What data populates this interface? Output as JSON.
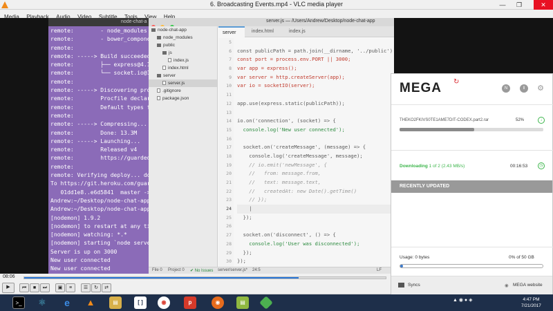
{
  "vlc": {
    "title": "6. Broadcasting Events.mp4 - VLC media player",
    "menu": [
      "Media",
      "Playback",
      "Audio",
      "Video",
      "Subtitle",
      "Tools",
      "View",
      "Help"
    ],
    "time_elapsed": "08:06",
    "progress": 0.76
  },
  "terminal": {
    "title": "node-chat-a",
    "lines": [
      "remote:        - node_modules",
      "remote:        - bower_componen",
      "remote:",
      "remote: -----> Build succeeded!",
      "remote:        ├── express@4.14",
      "remote:        └── socket.io@1.",
      "remote:",
      "remote: -----> Discovering proc",
      "remote:        Procfile declare",
      "remote:        Default types f",
      "remote:",
      "remote: -----> Compressing...",
      "remote:        Done: 13.3M",
      "remote: -----> Launching...",
      "remote:        Released v4",
      "remote:        https://guarded-",
      "remote:",
      "remote: Verifying deploy... do",
      "To https://git.heroku.com/guar",
      "   01dd1e8..e6d5841  master ->",
      "Andrew:~/Desktop/node-chat-app",
      "Andrew:~/Desktop/node-chat-app",
      "[nodemon] 1.9.2",
      "[nodemon] to restart at any ti",
      "[nodemon] watching: *.*",
      "[nodemon] starting `node server",
      "Server is up on 3000",
      "New user connected",
      "New user connected"
    ]
  },
  "atom": {
    "window_title": "server.js — /Users/Andrew/Desktop/node-chat-app",
    "tree": [
      {
        "label": "node-chat-app",
        "type": "folder",
        "indent": 0
      },
      {
        "label": "node_modules",
        "type": "folder",
        "indent": 1
      },
      {
        "label": "public",
        "type": "folder",
        "indent": 1
      },
      {
        "label": "js",
        "type": "folder",
        "indent": 2
      },
      {
        "label": "index.js",
        "type": "file",
        "indent": 3
      },
      {
        "label": "index.html",
        "type": "file",
        "indent": 2
      },
      {
        "label": "server",
        "type": "folder",
        "indent": 1
      },
      {
        "label": "server.js",
        "type": "file",
        "indent": 2,
        "selected": true
      },
      {
        "label": ".gitignore",
        "type": "file",
        "indent": 1
      },
      {
        "label": "package.json",
        "type": "file",
        "indent": 1
      }
    ],
    "tabs": [
      "server",
      "index.html",
      "index.js"
    ],
    "line_numbers": [
      "5",
      "6",
      "7",
      "8",
      "9",
      "10",
      "11",
      "12",
      "13",
      "14",
      "15",
      "16",
      "17",
      "18",
      "19",
      "20",
      "21",
      "22",
      "23",
      "24",
      "25",
      "26",
      "27",
      "28",
      "29",
      "30",
      "31",
      "32",
      "33",
      "34"
    ],
    "code_lines": [
      {
        "t": "",
        "c": ""
      },
      {
        "t": "const publicPath = path.join(__dirname, '../public');",
        "c": ""
      },
      {
        "t": "const port = process.env.PORT || 3000;",
        "c": "k"
      },
      {
        "t": "var app = express();",
        "c": "k"
      },
      {
        "t": "var server = http.createServer(app);",
        "c": "k"
      },
      {
        "t": "var io = socketIO(server);",
        "c": "k"
      },
      {
        "t": "",
        "c": ""
      },
      {
        "t": "app.use(express.static(publicPath));",
        "c": ""
      },
      {
        "t": "",
        "c": ""
      },
      {
        "t": "io.on('connection', (socket) => {",
        "c": ""
      },
      {
        "t": "  console.log('New user connected');",
        "c": "g"
      },
      {
        "t": "",
        "c": ""
      },
      {
        "t": "  socket.on('createMessage', (message) => {",
        "c": ""
      },
      {
        "t": "    console.log('createMessage', message);",
        "c": ""
      },
      {
        "t": "    // io.emit('newMessage', {",
        "c": "c"
      },
      {
        "t": "    //   from: message.from,",
        "c": "c"
      },
      {
        "t": "    //   text: message.text,",
        "c": "c"
      },
      {
        "t": "    //   createdAt: new Date().getTime()",
        "c": "c"
      },
      {
        "t": "    // });",
        "c": "c"
      },
      {
        "t": "    |",
        "c": "hl"
      },
      {
        "t": "  });",
        "c": ""
      },
      {
        "t": "",
        "c": ""
      },
      {
        "t": "  socket.on('disconnect', () => {",
        "c": ""
      },
      {
        "t": "    console.log('User was disconnected');",
        "c": "g"
      },
      {
        "t": "  });",
        "c": ""
      },
      {
        "t": "});",
        "c": ""
      },
      {
        "t": "",
        "c": ""
      },
      {
        "t": "server.listen(port, () => {",
        "c": ""
      },
      {
        "t": "  console.log(`Server is up on ${port}`);",
        "c": "g"
      },
      {
        "t": "});",
        "c": ""
      }
    ],
    "status": {
      "file": "File 0",
      "project": "Project 0",
      "issues": "✔ No Issues",
      "path": "server/server.js*",
      "cursor": "24:5",
      "encoding": "LF"
    }
  },
  "mega": {
    "logo": "MEGA",
    "filename": "THEKO2FKIVS0TE1AME7DIT-CODEX.part2.rar",
    "percent": "52%",
    "progress": 0.52,
    "status_word": "Downloading",
    "status_rest": "1 of 2 (2.43 MB/s)",
    "time_left": "00:16:53",
    "recent_label": "RECENTLY UPDATED",
    "usage_label": "Usage: 0 bytes",
    "quota": "0% of 50 GB",
    "usage_progress": 0.02,
    "syncs": "Syncs",
    "website": "MEGA website"
  },
  "taskbar": {
    "time": "4:47 PM",
    "date": "7/21/2017"
  }
}
